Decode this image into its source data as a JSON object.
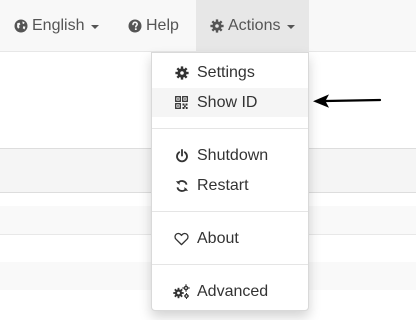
{
  "navbar": {
    "language": {
      "label": "English",
      "icon": "globe-icon"
    },
    "help": {
      "label": "Help",
      "icon": "question-circle-icon"
    },
    "actions": {
      "label": "Actions",
      "icon": "gear-icon"
    }
  },
  "actions_menu": {
    "items": [
      {
        "label": "Settings",
        "icon": "gear-icon"
      },
      {
        "label": "Show ID",
        "icon": "qrcode-icon",
        "highlighted": true
      },
      {
        "label": "Shutdown",
        "icon": "power-icon"
      },
      {
        "label": "Restart",
        "icon": "refresh-icon"
      },
      {
        "label": "About",
        "icon": "heart-outline-icon"
      },
      {
        "label": "Advanced",
        "icon": "gears-icon"
      }
    ]
  },
  "colors": {
    "navbar_bg": "#f8f8f8",
    "active_nav_bg": "#e7e7e7",
    "nav_text": "#555555",
    "menu_text": "#333333",
    "highlight_bg": "#f5f5f5",
    "arrow": "#000000"
  }
}
